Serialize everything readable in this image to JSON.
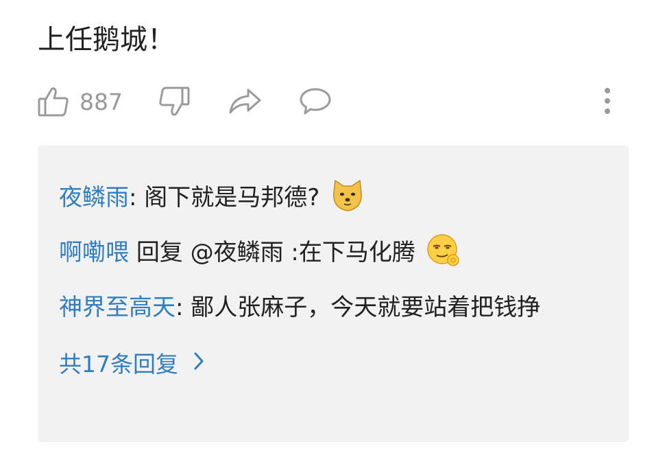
{
  "post": {
    "text": "上任鹅城！"
  },
  "actions": {
    "like_count": "887",
    "icons": [
      "thumbs-up-icon",
      "thumbs-down-icon",
      "share-icon",
      "comment-icon",
      "more-vert-icon"
    ]
  },
  "replies": [
    {
      "user": "夜鳞雨",
      "sep": ": ",
      "text": "阁下就是马邦德?",
      "emoji": "doge-emoji"
    },
    {
      "user": "啊嘞喂",
      "sep": " ",
      "text": "回复 @夜鳞雨 :在下马化腾",
      "emoji": "smirk-ok-emoji"
    },
    {
      "user": "神界至高天",
      "sep": ": ",
      "text": "鄙人张麻子，今天就要站着把钱挣",
      "emoji": ""
    }
  ],
  "view_all": {
    "label": "共17条回复"
  },
  "colors": {
    "link": "#2f7ec2",
    "icon_gray": "#9a9a9a",
    "panel_bg": "#f2f2f2",
    "text": "#212121"
  }
}
